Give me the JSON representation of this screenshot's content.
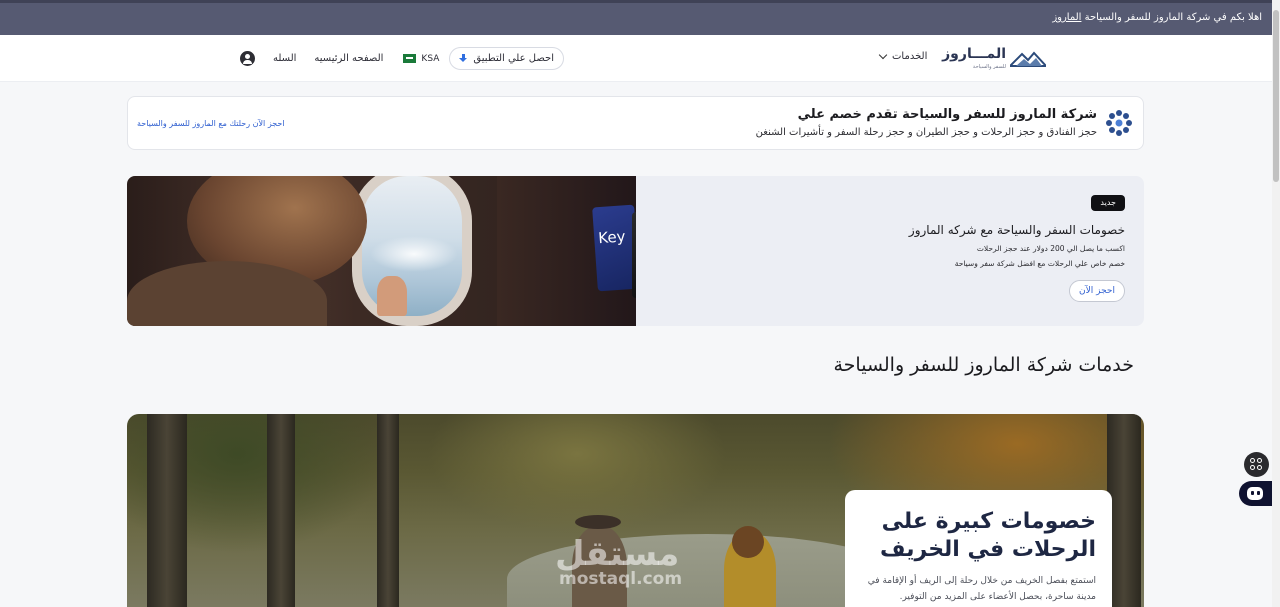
{
  "announcement": {
    "text": "اهلا بكم في شركة الماروز للسفر والسياحة ",
    "link": "الماروز"
  },
  "header": {
    "logo_text": "المـــاروز",
    "logo_subtitle": "للسفر والسياحة",
    "services_label": "الخدمات",
    "get_app_label": "احصل علي التطبيق",
    "country_label": "KSA",
    "home_label": "الصفحه الرئيسيه",
    "cart_label": "السله"
  },
  "promo": {
    "title": "شركة الماروز للسفر والسياحة تقدم خصم علي",
    "description": "حجز الفنادق و حجز الرحلات و حجز الطيران و حجز رحلة السفر و تأشيرات الشنغن",
    "cta": "احجز الآن رحلتك مع الماروز للسفر والسياحة"
  },
  "banner": {
    "badge": "جديد",
    "title": "خصومات السفر والسياحة مع شركه الماروز",
    "line1": "اكسب ما يصل الي 200 دولار عند حجز الرحلات",
    "line2": "خصم خاص علي الرحلات مع افضل شركة سفر وسياحة",
    "button": "احجز الآن",
    "card_text": "Key"
  },
  "section_title": "خدمات شركة الماروز للسفر والسياحة",
  "hero": {
    "title": "خصومات كبيرة على الرحلات في الخريف",
    "paragraph": "استمتع بفصل الخريف من خلال رحلة إلى الريف أو الإقامة في مدينة ساحرة، بحصل الأعضاء على المزيد من التوفير.",
    "watermark_ar": "مستقل",
    "watermark_en": "mostaql.com"
  },
  "icons": [
    "user-icon",
    "flag-icon",
    "download-icon",
    "chevron-down-icon",
    "logo-mountain-icon",
    "flower-icon",
    "apps-grid-icon",
    "chatbot-icon"
  ],
  "colors": {
    "topbar": "#565a72",
    "link_blue": "#2f5fd0",
    "badge_black": "#101014",
    "hero_title": "#1e2743"
  }
}
